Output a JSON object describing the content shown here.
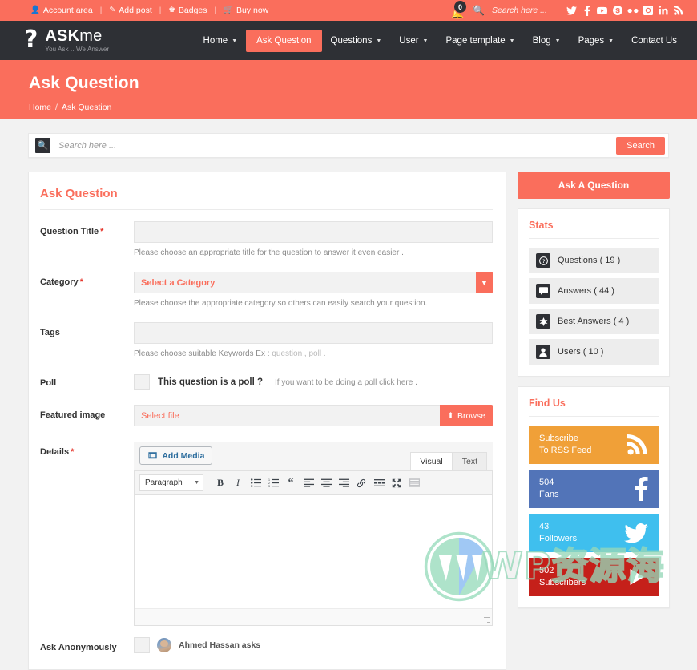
{
  "topbar": {
    "links": [
      {
        "icon": "user-icon",
        "glyph": "B",
        "label": "Account area"
      },
      {
        "icon": "pencil-icon",
        "glyph": "✎",
        "label": "Add post"
      },
      {
        "icon": "trophy-icon",
        "glyph": "♛",
        "label": "Badges"
      },
      {
        "icon": "cart-icon",
        "glyph": "⛟",
        "label": "Buy now"
      }
    ],
    "notification_count": "0",
    "search_placeholder": "Search here ...",
    "socials": [
      "twitter-icon",
      "facebook-icon",
      "youtube-icon",
      "skype-icon",
      "flickr-icon",
      "instagram-icon",
      "linkedin-icon",
      "rss-icon"
    ]
  },
  "brand": {
    "mark": "?",
    "name_bold": "ASK",
    "name_light": "me",
    "tagline": "You Ask .. We Answer"
  },
  "nav": [
    {
      "label": "Home",
      "has_caret": true,
      "active": false
    },
    {
      "label": "Ask Question",
      "has_caret": false,
      "active": true
    },
    {
      "label": "Questions",
      "has_caret": true,
      "active": false
    },
    {
      "label": "User",
      "has_caret": true,
      "active": false
    },
    {
      "label": "Page template",
      "has_caret": true,
      "active": false
    },
    {
      "label": "Blog",
      "has_caret": true,
      "active": false
    },
    {
      "label": "Pages",
      "has_caret": true,
      "active": false
    },
    {
      "label": "Contact Us",
      "has_caret": false,
      "active": false
    }
  ],
  "pagehead": {
    "title": "Ask Question",
    "crumb_home": "Home",
    "crumb_sep": "/",
    "crumb_current": "Ask Question"
  },
  "search": {
    "placeholder": "Search here ...",
    "button": "Search"
  },
  "form": {
    "title": "Ask Question",
    "question_title": {
      "label": "Question Title",
      "required": "*",
      "value": "",
      "hint": "Please choose an appropriate title for the question to answer it even easier ."
    },
    "category": {
      "label": "Category",
      "required": "*",
      "value": "Select a Category",
      "hint": "Please choose the appropriate category so others can easily search your question."
    },
    "tags": {
      "label": "Tags",
      "value": "",
      "hint_prefix": "Please choose suitable Keywords Ex : ",
      "hint_example": "question , poll ."
    },
    "poll": {
      "label": "Poll",
      "checkbox_label": "This question is a poll ?",
      "note": "If you want to be doing a poll click here ."
    },
    "featured_image": {
      "label": "Featured image",
      "value": "Select file",
      "browse": "Browse"
    },
    "details": {
      "label": "Details",
      "required": "*",
      "add_media": "Add Media",
      "tab_visual": "Visual",
      "tab_text": "Text",
      "format_select": "Paragraph",
      "toolbar": [
        "bold-icon",
        "italic-icon",
        "bulleted-list-icon",
        "numbered-list-icon",
        "blockquote-icon",
        "align-left-icon",
        "align-center-icon",
        "align-right-icon",
        "link-icon",
        "more-tag-icon",
        "fullscreen-icon",
        "kitchen-sink-icon"
      ],
      "body": ""
    },
    "anonymous": {
      "label": "Ask Anonymously",
      "author": "Ahmed Hassan asks"
    }
  },
  "sidebar": {
    "ask_button": "Ask A Question",
    "stats": {
      "title": "Stats",
      "items": [
        {
          "icon": "question-mark-icon",
          "label": "Questions ( 19 )"
        },
        {
          "icon": "comment-icon",
          "label": "Answers ( 44 )"
        },
        {
          "icon": "star-icon",
          "label": "Best Answers ( 4 )"
        },
        {
          "icon": "user-icon",
          "label": "Users ( 10 )"
        }
      ]
    },
    "findus": {
      "title": "Find Us",
      "boxes": [
        {
          "icon": "rss-icon",
          "line1": "Subscribe",
          "line2": "To RSS Feed",
          "color": "#f0a038"
        },
        {
          "icon": "facebook-icon",
          "line1": "504",
          "line2": "Fans",
          "color": "#5274b8"
        },
        {
          "icon": "twitter-icon",
          "line1": "43",
          "line2": "Followers",
          "color": "#3fbfee"
        },
        {
          "icon": "youtube-icon",
          "line1": "502",
          "line2": "Subscribers",
          "color": "#c5201a"
        }
      ]
    }
  },
  "watermark": {
    "text": "WP资源海"
  },
  "colors": {
    "accent": "#fa6e5c",
    "navbar": "#2e3035",
    "page_bg": "#f2f2f2"
  }
}
